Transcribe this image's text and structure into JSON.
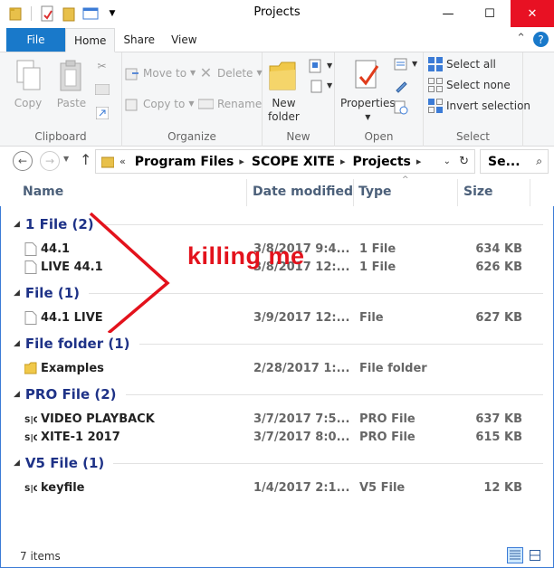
{
  "window": {
    "title": "Projects",
    "minimize": "—",
    "maximize": "☐",
    "close": "✕"
  },
  "ribbon_tabs": [
    "File",
    "Home",
    "Share",
    "View"
  ],
  "clipboard": {
    "copy": "Copy",
    "paste": "Paste",
    "label": "Clipboard"
  },
  "organize": {
    "move_to": "Move to",
    "copy_to": "Copy to",
    "delete": "Delete",
    "rename": "Rename",
    "label": "Organize"
  },
  "new": {
    "new_folder_line1": "New",
    "new_folder_line2": "folder",
    "label": "New"
  },
  "open": {
    "properties": "Properties",
    "label": "Open"
  },
  "select": {
    "select_all": "Select all",
    "select_none": "Select none",
    "invert": "Invert selection",
    "label": "Select"
  },
  "address": {
    "prefix": "«",
    "crumbs": [
      "Program Files",
      "SCOPE XITE",
      "Projects"
    ],
    "search_placeholder": "Se..."
  },
  "columns": {
    "name": "Name",
    "date": "Date modified",
    "type": "Type",
    "size": "Size"
  },
  "groups": [
    {
      "title": "1 File (2)",
      "items": [
        {
          "name": "44.1",
          "date": "3/8/2017 9:4...",
          "type": "1 File",
          "size": "634 KB",
          "icon": "blank-file-icon"
        },
        {
          "name": "LIVE 44.1",
          "date": "3/8/2017 12:...",
          "type": "1 File",
          "size": "626 KB",
          "icon": "blank-file-icon"
        }
      ]
    },
    {
      "title": "File (1)",
      "items": [
        {
          "name": "44.1 LIVE",
          "date": "3/9/2017 12:...",
          "type": "File",
          "size": "627 KB",
          "icon": "blank-file-icon"
        }
      ]
    },
    {
      "title": "File folder (1)",
      "items": [
        {
          "name": "Examples",
          "date": "2/28/2017 1:...",
          "type": "File folder",
          "size": "",
          "icon": "folder-icon"
        }
      ]
    },
    {
      "title": "PRO File (2)",
      "items": [
        {
          "name": "VIDEO PLAYBACK",
          "date": "3/7/2017 7:5...",
          "type": "PRO File",
          "size": "637 KB",
          "icon": "scope-file-icon"
        },
        {
          "name": "XITE-1 2017",
          "date": "3/7/2017 8:0...",
          "type": "PRO File",
          "size": "615 KB",
          "icon": "scope-file-icon"
        }
      ]
    },
    {
      "title": "V5 File (1)",
      "items": [
        {
          "name": "keyfile",
          "date": "1/4/2017 2:1...",
          "type": "V5 File",
          "size": "12 KB",
          "icon": "scope-file-icon"
        }
      ]
    }
  ],
  "annotation": "killing me",
  "status": {
    "count": "7 items"
  }
}
